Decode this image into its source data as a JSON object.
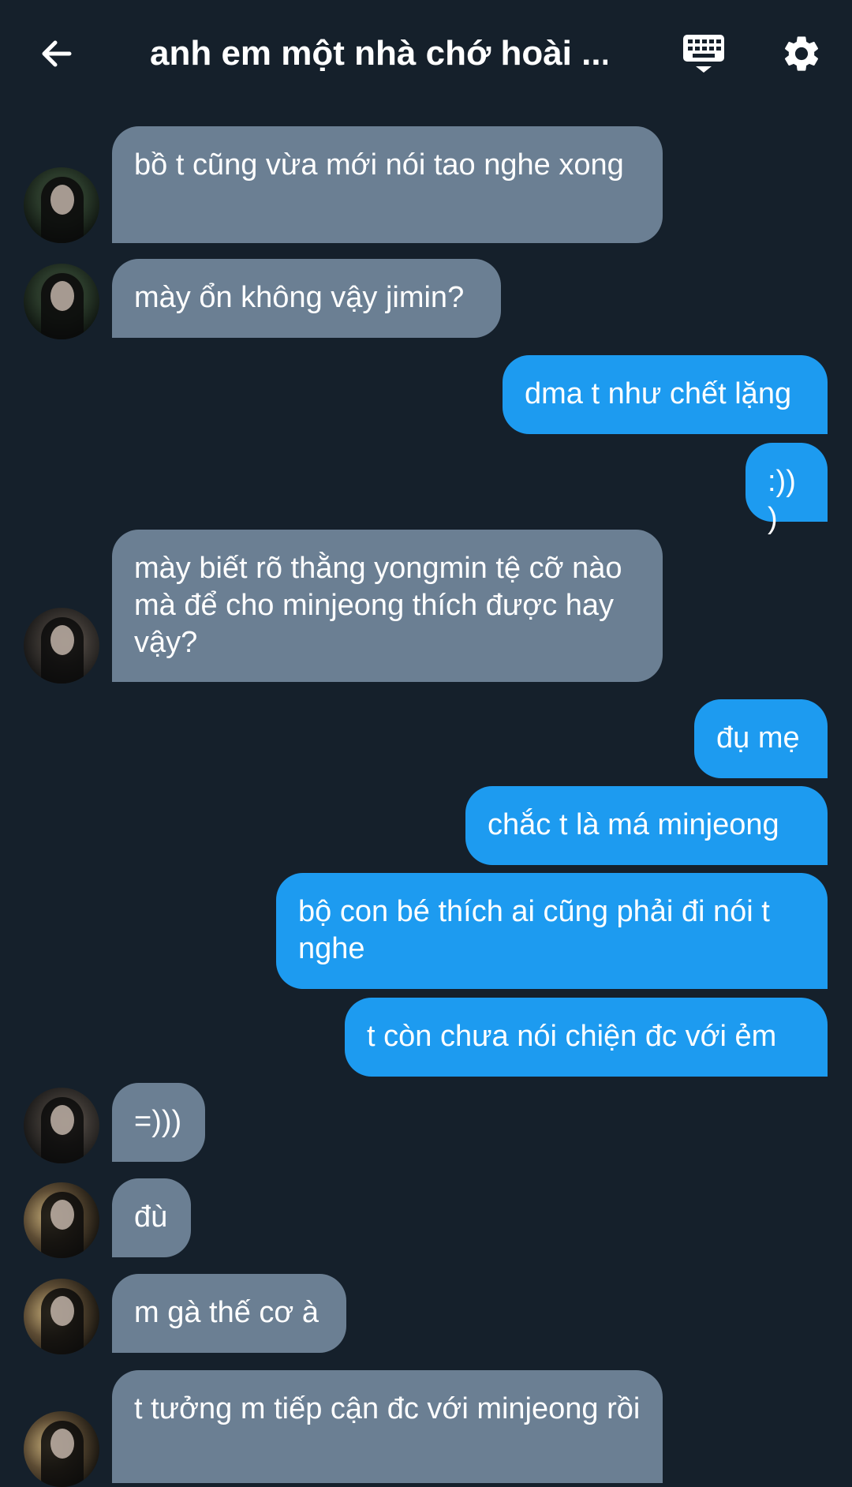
{
  "header": {
    "title": "anh em một nhà chớ hoài ...",
    "back_icon": "arrow-left-icon",
    "keyboard_icon": "keyboard-icon",
    "settings_icon": "gear-icon"
  },
  "colors": {
    "background": "#15202b",
    "incoming_bubble": "#6b7f93",
    "outgoing_bubble": "#1d9bf0",
    "text": "#ffffff"
  },
  "messages": [
    {
      "direction": "in",
      "avatar": "avatar-a",
      "text": "bồ t cũng vừa mới nói tao nghe xong"
    },
    {
      "direction": "in",
      "avatar": "avatar-a",
      "text": "mày ổn không vậy jimin?"
    },
    {
      "direction": "out",
      "text": "dma t như chết lặng"
    },
    {
      "direction": "out",
      "text": ":)))"
    },
    {
      "direction": "in",
      "avatar": "avatar-b",
      "text": "mày biết rõ thằng yongmin tệ cỡ nào mà để cho minjeong thích được hay vậy?"
    },
    {
      "direction": "out",
      "text": "đụ mẹ"
    },
    {
      "direction": "out",
      "text": "chắc t là má minjeong"
    },
    {
      "direction": "out",
      "text": "bộ con bé thích ai cũng phải đi nói t nghe"
    },
    {
      "direction": "out",
      "text": "t còn chưa nói chiện đc với ẻm"
    },
    {
      "direction": "in",
      "avatar": "avatar-b",
      "text": "=)))"
    },
    {
      "direction": "in",
      "avatar": "avatar-c",
      "text": "đù"
    },
    {
      "direction": "in",
      "avatar": "avatar-c",
      "text": "m gà thế cơ à"
    },
    {
      "direction": "in",
      "avatar": "avatar-c",
      "text": "t tưởng m tiếp cận đc với minjeong rồi"
    }
  ]
}
